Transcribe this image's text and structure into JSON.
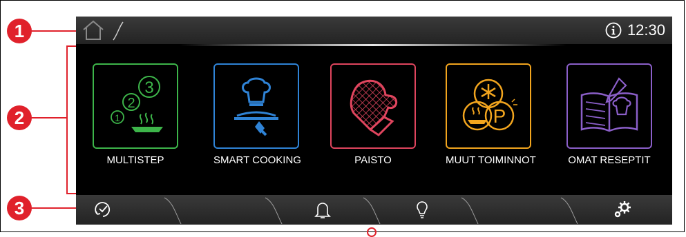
{
  "callouts": [
    "1",
    "2",
    "3"
  ],
  "topbar": {
    "home_icon": "home-icon",
    "info_icon": "info-icon",
    "time": "12:30"
  },
  "tiles": [
    {
      "label": "MULTISTEP",
      "color": "#3db54a",
      "icon": "multistep-icon"
    },
    {
      "label": "SMART COOKING",
      "color": "#2f83d6",
      "icon": "chef-serving-icon"
    },
    {
      "label": "PAISTO",
      "color": "#e0455e",
      "icon": "oven-mitt-icon"
    },
    {
      "label": "MUUT TOIMINNOT",
      "color": "#f2a51e",
      "icon": "other-functions-icon"
    },
    {
      "label": "OMAT RESEPTIT",
      "color": "#8b5fc9",
      "icon": "recipe-book-icon"
    }
  ],
  "bottombar": {
    "icons": [
      "timer-icon",
      "bell-icon",
      "bulb-icon",
      "settings-icon"
    ]
  },
  "colors": {
    "accent": "#e0212b",
    "screen_bg": "#000000"
  }
}
